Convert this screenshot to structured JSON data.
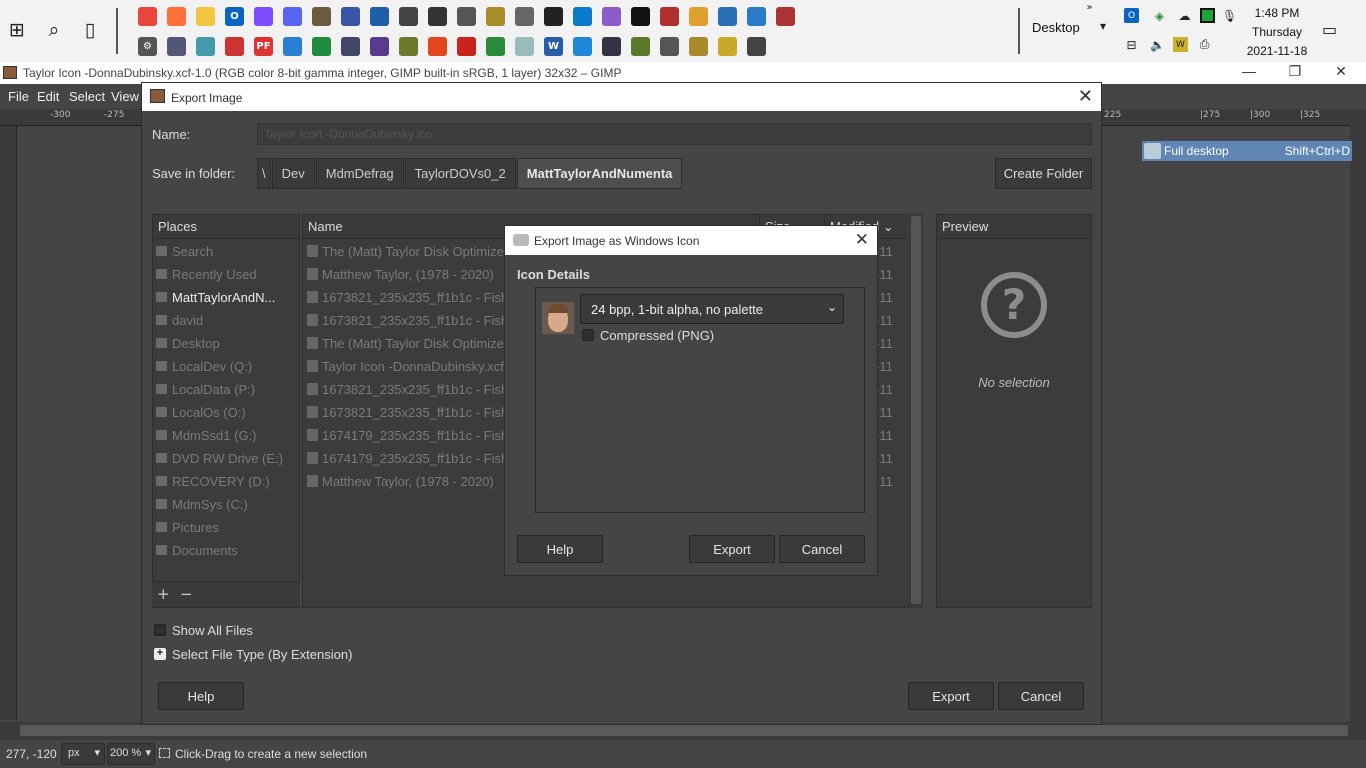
{
  "taskbar": {
    "desktop_label": "Desktop",
    "time": "1:48 PM",
    "day": "Thursday",
    "date": "2021-11-18",
    "icons_row1": [
      {
        "name": "chrome-icon",
        "color": "#e8453c",
        "glyph": ""
      },
      {
        "name": "firefox-icon",
        "color": "#ff7139",
        "glyph": ""
      },
      {
        "name": "file-explorer-icon",
        "color": "#f4c542",
        "glyph": ""
      },
      {
        "name": "outlook-icon",
        "color": "#0a64c2",
        "glyph": "O"
      },
      {
        "name": "messenger-icon",
        "color": "#7b4dff",
        "glyph": ""
      },
      {
        "name": "discord-icon",
        "color": "#5865f2",
        "glyph": ""
      },
      {
        "name": "gimp-icon",
        "color": "#6b5a3e",
        "glyph": ""
      },
      {
        "name": "visio-icon",
        "color": "#3955a3",
        "glyph": ""
      },
      {
        "name": "photos-icon",
        "color": "#1e5fa8",
        "glyph": ""
      },
      {
        "name": "app-icon-1",
        "color": "#444",
        "glyph": ""
      },
      {
        "name": "app-icon-2",
        "color": "#333",
        "glyph": ""
      },
      {
        "name": "app-icon-3",
        "color": "#555",
        "glyph": ""
      },
      {
        "name": "app-icon-4",
        "color": "#a68d2b",
        "glyph": ""
      },
      {
        "name": "app-icon-5",
        "color": "#666",
        "glyph": ""
      },
      {
        "name": "terminal-icon",
        "color": "#222",
        "glyph": ""
      },
      {
        "name": "vscode-icon",
        "color": "#0a7acb",
        "glyph": ""
      },
      {
        "name": "visual-studio-icon",
        "color": "#8e5cc9",
        "glyph": ""
      },
      {
        "name": "cmd-icon",
        "color": "#111",
        "glyph": ""
      },
      {
        "name": "app-icon-6",
        "color": "#b03030",
        "glyph": ""
      },
      {
        "name": "app-icon-7",
        "color": "#e0a030",
        "glyph": ""
      },
      {
        "name": "powershell-icon",
        "color": "#2a6fb5",
        "glyph": ""
      },
      {
        "name": "app-icon-8",
        "color": "#2a7cc7",
        "glyph": ""
      },
      {
        "name": "app-icon-9",
        "color": "#a33",
        "glyph": ""
      }
    ],
    "icons_row2": [
      {
        "name": "settings-icon",
        "color": "#555",
        "glyph": "⚙"
      },
      {
        "name": "app-icon-10",
        "color": "#557",
        "glyph": ""
      },
      {
        "name": "app-icon-11",
        "color": "#49a",
        "glyph": ""
      },
      {
        "name": "app-icon-12",
        "color": "#c33",
        "glyph": ""
      },
      {
        "name": "pdf-app-icon",
        "color": "#d33",
        "glyph": "PF"
      },
      {
        "name": "app-icon-13",
        "color": "#2a7fd4",
        "glyph": ""
      },
      {
        "name": "app-icon-14",
        "color": "#1e8e3e",
        "glyph": ""
      },
      {
        "name": "app-icon-15",
        "color": "#446",
        "glyph": ""
      },
      {
        "name": "app-icon-16",
        "color": "#5a3a8c",
        "glyph": ""
      },
      {
        "name": "app-icon-17",
        "color": "#6a7a2a",
        "glyph": ""
      },
      {
        "name": "office-icon",
        "color": "#e2461c",
        "glyph": ""
      },
      {
        "name": "acrobat-icon",
        "color": "#c8231c",
        "glyph": ""
      },
      {
        "name": "app-icon-18",
        "color": "#2a8a3a",
        "glyph": ""
      },
      {
        "name": "app-icon-19",
        "color": "#9bb",
        "glyph": ""
      },
      {
        "name": "word-icon",
        "color": "#2b5aa8",
        "glyph": "W"
      },
      {
        "name": "app-icon-20",
        "color": "#1e88d8",
        "glyph": ""
      },
      {
        "name": "app-icon-21",
        "color": "#334",
        "glyph": ""
      },
      {
        "name": "app-icon-22",
        "color": "#5a7a2a",
        "glyph": ""
      },
      {
        "name": "app-icon-23",
        "color": "#555",
        "glyph": ""
      },
      {
        "name": "app-icon-24",
        "color": "#a88a2a",
        "glyph": ""
      },
      {
        "name": "app-icon-25",
        "color": "#c9a82a",
        "glyph": ""
      },
      {
        "name": "app-icon-26",
        "color": "#444",
        "glyph": ""
      }
    ]
  },
  "gimp": {
    "title": "Taylor Icon -DonnaDubinsky.xcf-1.0 (RGB color 8-bit gamma integer, GIMP built-in sRGB, 1 layer) 32x32 – GIMP",
    "menu": [
      "File",
      "Edit",
      "Select",
      "View"
    ],
    "ruler_left_labels": [
      "-300",
      "-275"
    ],
    "ruler_right_labels": [
      "225",
      "|275",
      "|300",
      "|325"
    ],
    "status": {
      "coords": "277, -120",
      "unit": "px",
      "zoom": "200 %",
      "message": "Click-Drag to create a new selection"
    },
    "shortcut": {
      "label": "Full desktop",
      "keys": "Shift+Ctrl+D"
    }
  },
  "export_dialog": {
    "title": "Export Image",
    "name_label": "Name:",
    "name_value": "Taylor Icon -DonnaDubinsky.ico",
    "folder_label": "Save in folder:",
    "breadcrumb": [
      "\\",
      "Dev",
      "MdmDefrag",
      "TaylorDOVs0_2",
      "MattTaylorAndNumenta"
    ],
    "create_folder": "Create Folder",
    "places_header": "Places",
    "places": [
      "Search",
      "Recently Used",
      "MattTaylorAndN...",
      "david",
      "Desktop",
      "LocalDev (Q:)",
      "LocalData (P:)",
      "LocalOs (O:)",
      "MdmSsd1 (G:)",
      "DVD RW Drive (E:)",
      "RECOVERY (D:)",
      "MdmSys (C:)",
      "Pictures",
      "Documents"
    ],
    "columns": {
      "name": "Name",
      "size": "Size",
      "modified": "Modified"
    },
    "files": [
      {
        "name": "The (Matt) Taylor Disk Optimizer",
        "modified": "-11"
      },
      {
        "name": "Matthew Taylor, (1978 - 2020)",
        "modified": "-11"
      },
      {
        "name": "1673821_235x235_ff1b1c - Fish",
        "modified": "-11"
      },
      {
        "name": "1673821_235x235_ff1b1c - Fish",
        "modified": "-11"
      },
      {
        "name": "The (Matt) Taylor Disk Optimizer",
        "modified": "-11"
      },
      {
        "name": "Taylor Icon -DonnaDubinsky.xcf",
        "modified": "-11"
      },
      {
        "name": "1673821_235x235_ff1b1c - Fish",
        "modified": "-11"
      },
      {
        "name": "1673821_235x235_ff1b1c - Fish",
        "modified": "-11"
      },
      {
        "name": "1674179_235x235_ff1b1c - Fish",
        "modified": "-11"
      },
      {
        "name": "1674179_235x235_ff1b1c - Fish",
        "modified": "-11"
      },
      {
        "name": "Matthew Taylor, (1978 - 2020)",
        "modified": "-11"
      }
    ],
    "preview_header": "Preview",
    "preview_empty": "No selection",
    "show_all_files": "Show All Files",
    "select_file_type": "Select File Type (By Extension)",
    "help": "Help",
    "export": "Export",
    "cancel": "Cancel"
  },
  "icon_dialog": {
    "title": "Export Image as Windows Icon",
    "heading": "Icon Details",
    "format_selected": "24 bpp, 1-bit alpha, no palette",
    "compressed_label": "Compressed (PNG)",
    "help": "Help",
    "export": "Export",
    "cancel": "Cancel"
  }
}
